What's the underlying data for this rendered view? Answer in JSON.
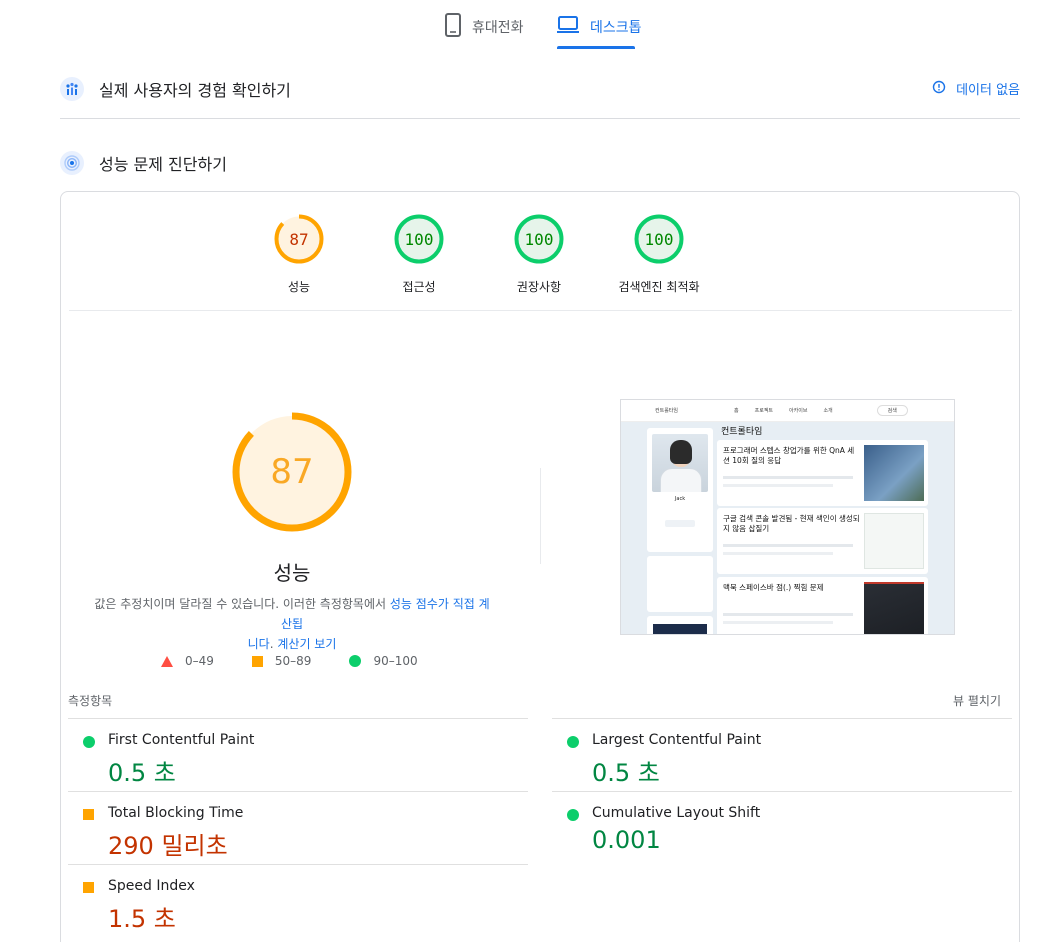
{
  "device_tabs": {
    "mobile": {
      "label": "휴대전화",
      "icon": "phone-icon"
    },
    "desktop": {
      "label": "데스크톱",
      "icon": "laptop-icon",
      "active": true
    }
  },
  "field_section": {
    "title": "실제 사용자의 경험 확인하기",
    "no_data_label": "데이터 없음"
  },
  "lab_section": {
    "title": "성능 문제 진단하기"
  },
  "gauges": [
    {
      "value": "87",
      "label": "성능",
      "score": 87,
      "color": "#ffa400",
      "text_color": "#c33300",
      "bg": "#fff3e0"
    },
    {
      "value": "100",
      "label": "접근성",
      "score": 100,
      "color": "#0cce6b",
      "text_color": "#008800",
      "bg": "#e6f4ea"
    },
    {
      "value": "100",
      "label": "권장사항",
      "score": 100,
      "color": "#0cce6b",
      "text_color": "#008800",
      "bg": "#e6f4ea"
    },
    {
      "value": "100",
      "label": "검색엔진 최적화",
      "score": 100,
      "color": "#0cce6b",
      "text_color": "#008800",
      "bg": "#e6f4ea"
    }
  ],
  "performance": {
    "score": "87",
    "score_fraction": 0.87,
    "title": "성능",
    "desc_prefix": "값은 추정치이며 달라질 수 있습니다. 이러한 측정항목에서 ",
    "desc_link1": "성능 점수가 직접 계산됩",
    "desc_link1b": "니다",
    "desc_mid": ". ",
    "desc_link2": "계산기 보기"
  },
  "legend": {
    "fail": "0–49",
    "average": "50–89",
    "pass": "90–100"
  },
  "screenshot": {
    "site_name": "컨트롤타임",
    "nav": [
      "홈",
      "프로젝트",
      "아카이브",
      "소개"
    ],
    "search": "검색",
    "profile_name": "Jack",
    "posts": [
      "프로그래머 스텝스 창업가를 위한 QnA 세션 10회 질의 응답",
      "구글 검색 콘솔 발견됨 - 현재 색인이 생성되지 않음 삽질기",
      "맥북 스페이스바 점(.) 찍힘 문제"
    ]
  },
  "metrics": {
    "header": "측정항목",
    "expand_label": "뷰 펼치기",
    "items": [
      {
        "name": "First Contentful Paint",
        "value": "0.5 초",
        "status": "pass"
      },
      {
        "name": "Largest Contentful Paint",
        "value": "0.5 초",
        "status": "pass"
      },
      {
        "name": "Total Blocking Time",
        "value": "290 밀리초",
        "status": "average"
      },
      {
        "name": "Cumulative Layout Shift",
        "value": "0.001",
        "status": "pass"
      },
      {
        "name": "Speed Index",
        "value": "1.5 초",
        "status": "average"
      }
    ]
  }
}
